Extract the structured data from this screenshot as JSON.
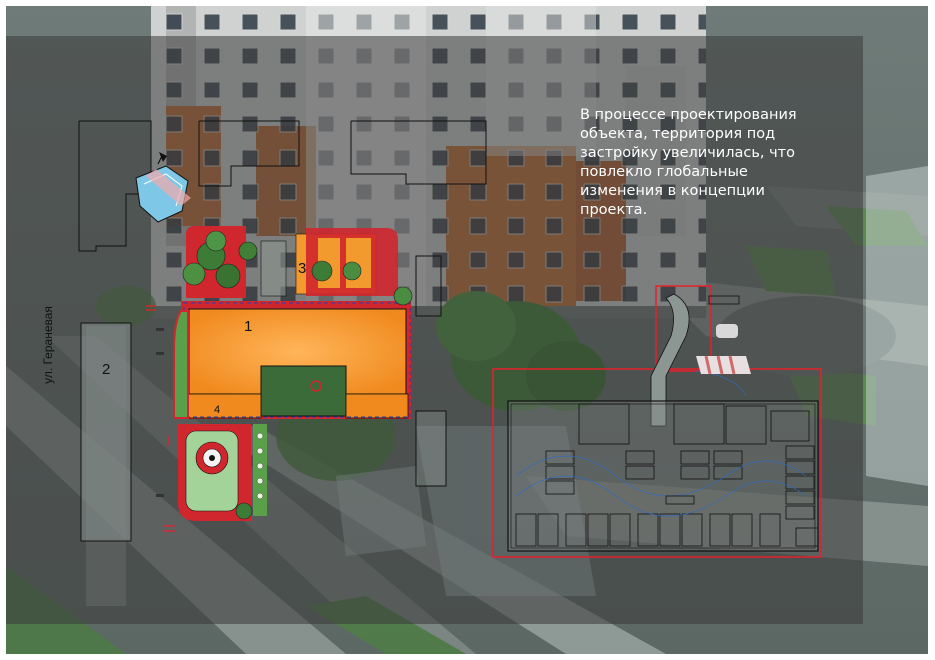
{
  "description_text": "В процессе проектирования\nобъекта, территория под\nзастройку увеличилась, что\nповлекло глобальные\nизменения в концепции\nпроекта.",
  "street_label": "ул. Гераневая",
  "plan_numbers": {
    "n1": "1",
    "n2": "2",
    "n3": "3",
    "n4": "4"
  },
  "colors": {
    "overlay": "#3a3a3a",
    "building_orange": "#f39a2e",
    "paving_red": "#d1262d",
    "lawn_green": "#5aa04a",
    "parking_outline": "#e8202a",
    "facade_orange": "#c27035"
  }
}
